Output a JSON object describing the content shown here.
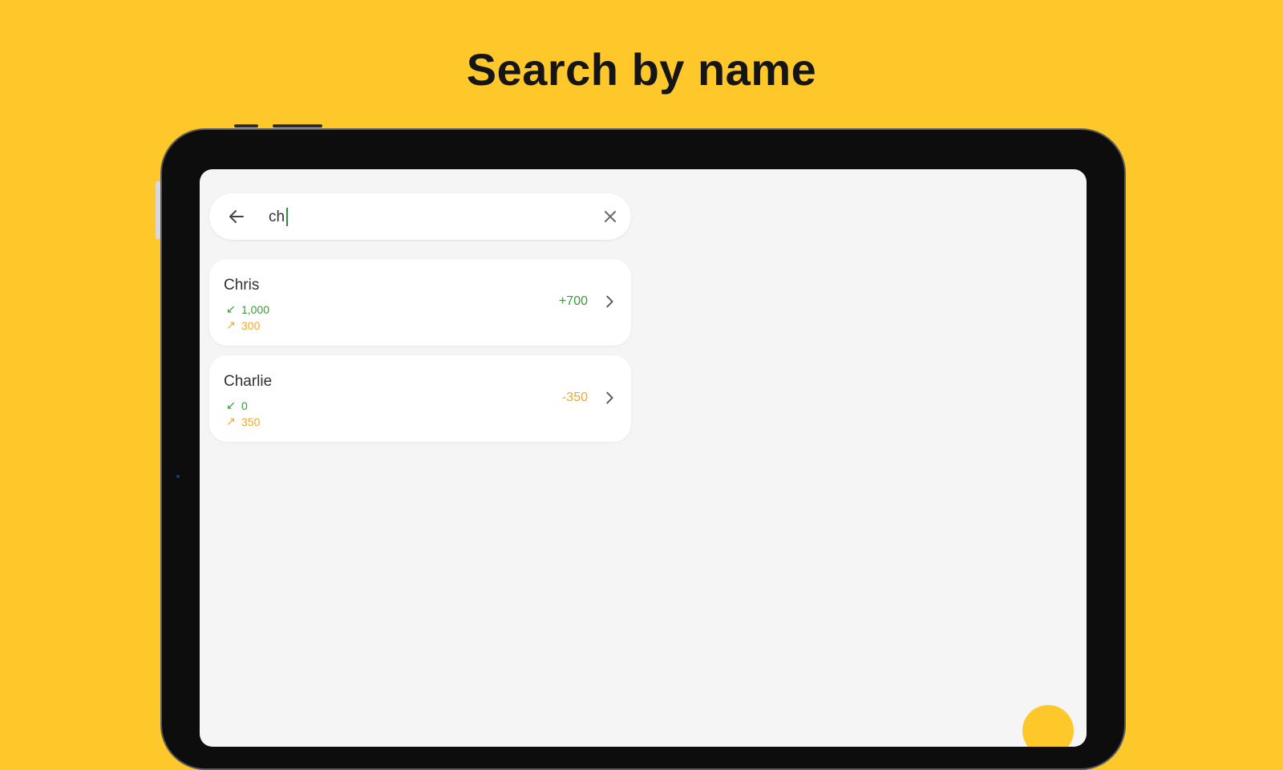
{
  "headline": "Search by name",
  "colors": {
    "background": "#FEC72A",
    "screen": "#F5F5F5",
    "positive": "#3a9a3a",
    "negative": "#F5A623"
  },
  "search": {
    "value": "ch",
    "back_icon": "arrow-left-icon",
    "clear_icon": "close-icon"
  },
  "results": [
    {
      "name": "Chris",
      "received": "1,000",
      "sent": "300",
      "balance": "+700",
      "balance_type": "positive"
    },
    {
      "name": "Charlie",
      "received": "0",
      "sent": "350",
      "balance": "-350",
      "balance_type": "negative"
    }
  ],
  "icons": {
    "received": "arrow-down-left-icon",
    "sent": "arrow-up-right-icon",
    "open": "chevron-right-icon",
    "fab": "fab-button"
  }
}
